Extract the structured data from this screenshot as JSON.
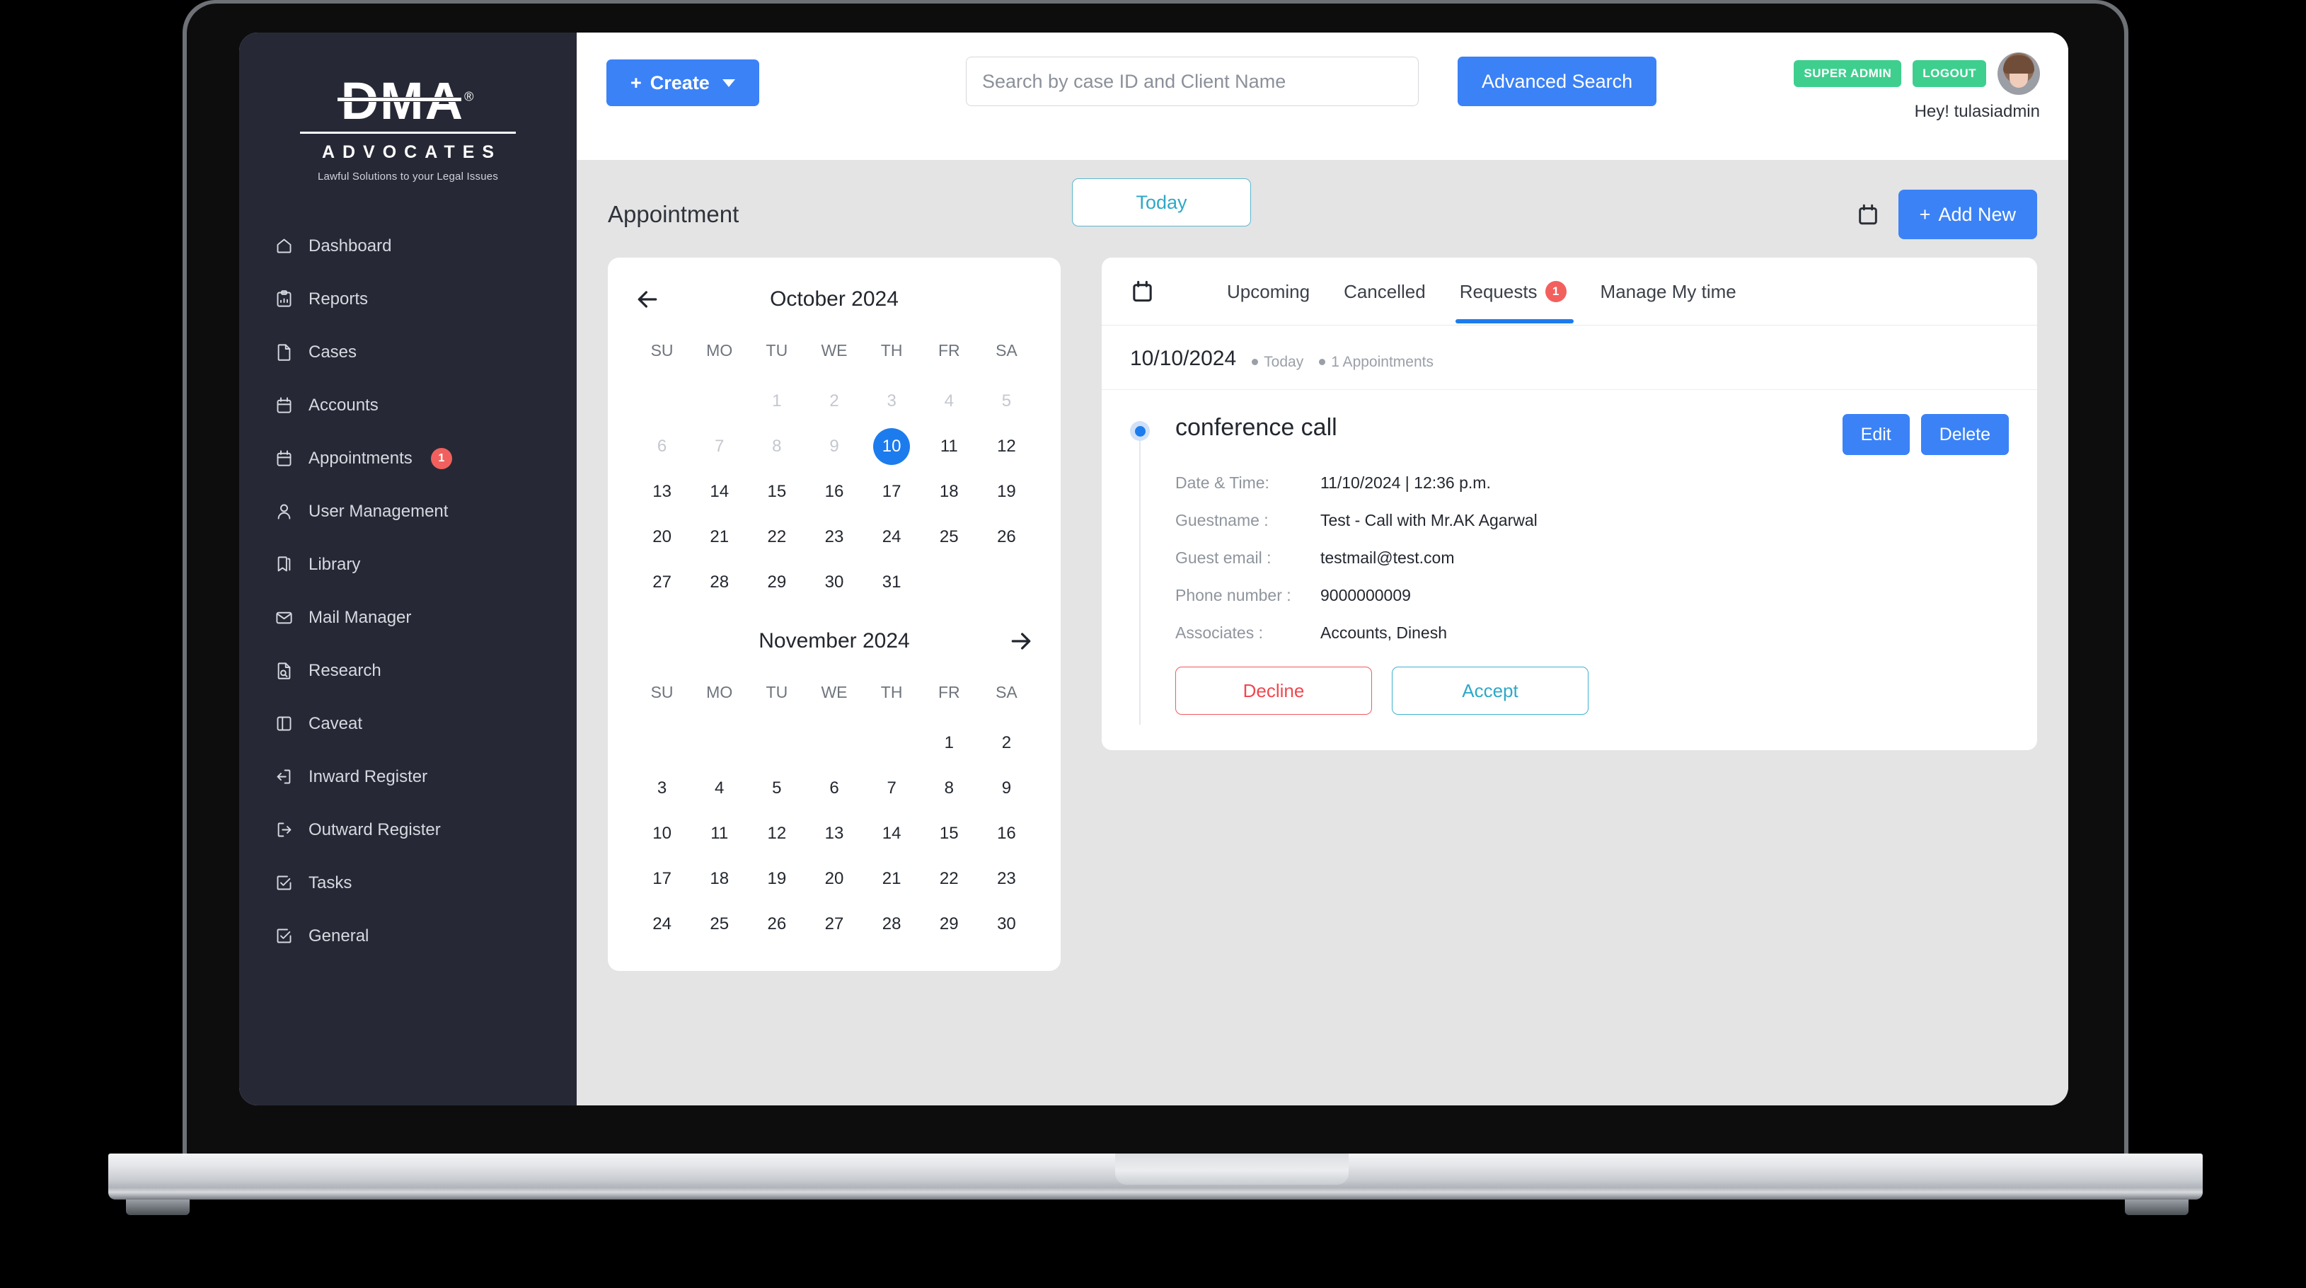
{
  "brand": {
    "name": "DMA",
    "registered": "®",
    "subtitle": "ADVOCATES",
    "tagline": "Lawful Solutions to your Legal Issues"
  },
  "sidebar": {
    "items": [
      {
        "label": "Dashboard",
        "icon": "home-icon"
      },
      {
        "label": "Reports",
        "icon": "report-clipboard-icon"
      },
      {
        "label": "Cases",
        "icon": "document-icon"
      },
      {
        "label": "Accounts",
        "icon": "calendar-icon"
      },
      {
        "label": "Appointments",
        "icon": "calendar-icon",
        "badge": "1"
      },
      {
        "label": "User Management",
        "icon": "user-icon"
      },
      {
        "label": "Library",
        "icon": "bookmark-icon"
      },
      {
        "label": "Mail Manager",
        "icon": "envelope-icon"
      },
      {
        "label": "Research",
        "icon": "document-search-icon"
      },
      {
        "label": "Caveat",
        "icon": "panel-icon"
      },
      {
        "label": "Inward Register",
        "icon": "arrow-in-icon"
      },
      {
        "label": "Outward Register",
        "icon": "arrow-out-icon"
      },
      {
        "label": "Tasks",
        "icon": "checkbox-icon"
      },
      {
        "label": "General",
        "icon": "checkbox-icon"
      }
    ]
  },
  "topbar": {
    "create_label": "Create",
    "search_placeholder": "Search by case ID and Client Name",
    "search_value": "",
    "advanced_search_label": "Advanced Search",
    "role_badge": "SUPER ADMIN",
    "logout_label": "LOGOUT",
    "greeting": "Hey! tulasiadmin"
  },
  "page": {
    "title": "Appointment",
    "today_label": "Today",
    "add_new_label": "Add New",
    "calendar_icon": "calendar-icon"
  },
  "calendar": {
    "prev_icon": "arrow-left-icon",
    "next_icon": "arrow-right-icon",
    "day_names": [
      "SU",
      "MO",
      "TU",
      "WE",
      "TH",
      "FR",
      "SA"
    ],
    "months": [
      {
        "title": "October 2024",
        "lead_blanks": 2,
        "days": [
          {
            "n": "1",
            "state": "muted"
          },
          {
            "n": "2",
            "state": "muted"
          },
          {
            "n": "3",
            "state": "muted"
          },
          {
            "n": "4",
            "state": "muted"
          },
          {
            "n": "5",
            "state": "muted"
          },
          {
            "n": "6",
            "state": "muted"
          },
          {
            "n": "7",
            "state": "muted"
          },
          {
            "n": "8",
            "state": "muted"
          },
          {
            "n": "9",
            "state": "muted"
          },
          {
            "n": "10",
            "state": "selected"
          },
          {
            "n": "11",
            "state": "normal"
          },
          {
            "n": "12",
            "state": "normal"
          },
          {
            "n": "13",
            "state": "normal"
          },
          {
            "n": "14",
            "state": "normal"
          },
          {
            "n": "15",
            "state": "normal"
          },
          {
            "n": "16",
            "state": "normal"
          },
          {
            "n": "17",
            "state": "normal"
          },
          {
            "n": "18",
            "state": "normal"
          },
          {
            "n": "19",
            "state": "normal"
          },
          {
            "n": "20",
            "state": "normal"
          },
          {
            "n": "21",
            "state": "normal"
          },
          {
            "n": "22",
            "state": "normal"
          },
          {
            "n": "23",
            "state": "normal"
          },
          {
            "n": "24",
            "state": "normal"
          },
          {
            "n": "25",
            "state": "normal"
          },
          {
            "n": "26",
            "state": "normal"
          },
          {
            "n": "27",
            "state": "normal"
          },
          {
            "n": "28",
            "state": "normal"
          },
          {
            "n": "29",
            "state": "normal"
          },
          {
            "n": "30",
            "state": "normal"
          },
          {
            "n": "31",
            "state": "normal"
          }
        ]
      },
      {
        "title": "November 2024",
        "lead_blanks": 5,
        "days": [
          {
            "n": "1",
            "state": "normal"
          },
          {
            "n": "2",
            "state": "normal"
          },
          {
            "n": "3",
            "state": "normal"
          },
          {
            "n": "4",
            "state": "normal"
          },
          {
            "n": "5",
            "state": "normal"
          },
          {
            "n": "6",
            "state": "normal"
          },
          {
            "n": "7",
            "state": "normal"
          },
          {
            "n": "8",
            "state": "normal"
          },
          {
            "n": "9",
            "state": "normal"
          },
          {
            "n": "10",
            "state": "normal"
          },
          {
            "n": "11",
            "state": "normal"
          },
          {
            "n": "12",
            "state": "normal"
          },
          {
            "n": "13",
            "state": "normal"
          },
          {
            "n": "14",
            "state": "normal"
          },
          {
            "n": "15",
            "state": "normal"
          },
          {
            "n": "16",
            "state": "normal"
          },
          {
            "n": "17",
            "state": "normal"
          },
          {
            "n": "18",
            "state": "normal"
          },
          {
            "n": "19",
            "state": "normal"
          },
          {
            "n": "20",
            "state": "normal"
          },
          {
            "n": "21",
            "state": "normal"
          },
          {
            "n": "22",
            "state": "normal"
          },
          {
            "n": "23",
            "state": "normal"
          },
          {
            "n": "24",
            "state": "normal"
          },
          {
            "n": "25",
            "state": "normal"
          },
          {
            "n": "26",
            "state": "normal"
          },
          {
            "n": "27",
            "state": "normal"
          },
          {
            "n": "28",
            "state": "normal"
          },
          {
            "n": "29",
            "state": "normal"
          },
          {
            "n": "30",
            "state": "normal"
          }
        ]
      }
    ]
  },
  "appointments_panel": {
    "tab_icon": "calendar-icon",
    "tabs": [
      {
        "label": "Upcoming",
        "active": false
      },
      {
        "label": "Cancelled",
        "active": false
      },
      {
        "label": "Requests",
        "active": true,
        "badge": "1"
      },
      {
        "label": "Manage My time",
        "active": false
      }
    ],
    "date": "10/10/2024",
    "today_chip": "Today",
    "count_chip": "1 Appointments",
    "appointment": {
      "title": "conference call",
      "edit_label": "Edit",
      "delete_label": "Delete",
      "fields": [
        {
          "label": "Date & Time:",
          "value": "11/10/2024 | 12:36 p.m."
        },
        {
          "label": "Guestname :",
          "value": "Test - Call with Mr.AK Agarwal"
        },
        {
          "label": "Guest email :",
          "value": "testmail@test.com"
        },
        {
          "label": "Phone number :",
          "value": "9000000009"
        },
        {
          "label": "Associates :",
          "value": "Accounts, Dinesh"
        }
      ],
      "decline_label": "Decline",
      "accept_label": "Accept"
    }
  },
  "colors": {
    "primary_blue": "#3b82f6",
    "selected_blue": "#1c7ced",
    "badge_red": "#f2605d",
    "green": "#3ecf8e",
    "teal": "#2fa8c7",
    "decline_red": "#f0484f",
    "sidebar_bg": "#262935",
    "page_bg": "#e4e4e4"
  }
}
